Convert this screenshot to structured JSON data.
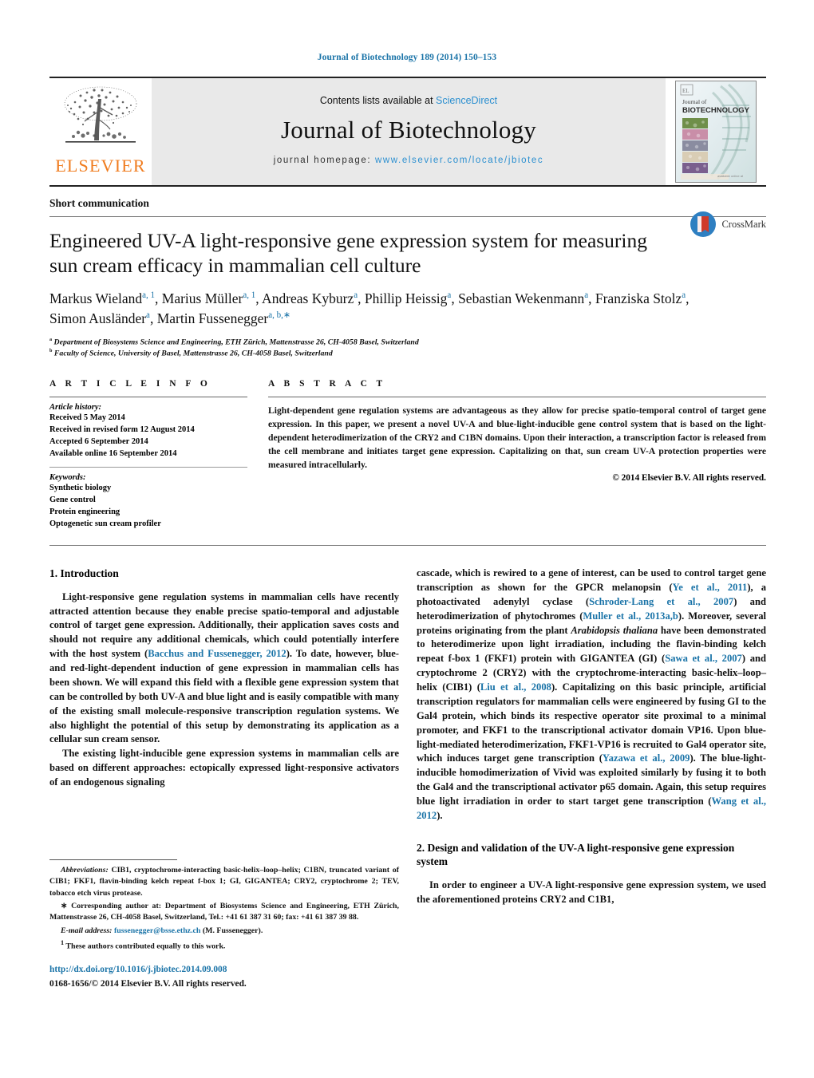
{
  "running_head": "Journal of Biotechnology 189 (2014) 150–153",
  "masthead": {
    "publisher_name": "ELSEVIER",
    "contents_prefix": "Contents lists available at ",
    "sciencedirect": "ScienceDirect",
    "journal_title": "Journal of Biotechnology",
    "homepage_label": "journal homepage:",
    "homepage_url": "www.elsevier.com/locate/jbiotec",
    "cover": {
      "line1": "Journal of",
      "line2": "BIOTECHNOLOGY"
    }
  },
  "article": {
    "section_type": "Short communication",
    "title": "Engineered UV-A light-responsive gene expression system for measuring sun cream efficacy in mammalian cell culture",
    "authors_html": "Markus Wieland<sup>a, 1</sup>, Marius Müller<sup>a, 1</sup>, Andreas Kyburz<sup>a</sup>, Phillip Heissig<sup>a</sup>, Sebastian Wekenmann<sup>a</sup>, Franziska Stolz<sup>a</sup>, Simon Ausländer<sup>a</sup>, Martin Fussenegger<sup>a, b,</sup><sup>∗</sup>",
    "affiliation_a": "Department of Biosystems Science and Engineering, ETH Zürich, Mattenstrasse 26, CH-4058 Basel, Switzerland",
    "affiliation_b": "Faculty of Science, University of Basel, Mattenstrasse 26, CH-4058 Basel, Switzerland",
    "crossmark_label": "CrossMark"
  },
  "article_info": {
    "heading": "A R T I C L E    I N F O",
    "history_label": "Article history:",
    "history": [
      "Received 5 May 2014",
      "Received in revised form 12 August 2014",
      "Accepted 6 September 2014",
      "Available online 16 September 2014"
    ],
    "keywords_label": "Keywords:",
    "keywords": [
      "Synthetic biology",
      "Gene control",
      "Protein engineering",
      "Optogenetic sun cream profiler"
    ]
  },
  "abstract": {
    "heading": "A B S T R A C T",
    "text": "Light-dependent gene regulation systems are advantageous as they allow for precise spatio-temporal control of target gene expression. In this paper, we present a novel UV-A and blue-light-inducible gene control system that is based on the light-dependent heterodimerization of the CRY2 and C1BN domains. Upon their interaction, a transcription factor is released from the cell membrane and initiates target gene expression. Capitalizing on that, sun cream UV-A protection properties were measured intracellularly.",
    "copyright": "© 2014 Elsevier B.V. All rights reserved."
  },
  "body": {
    "intro_heading": "1.  Introduction",
    "left_p1_html": "Light-responsive gene regulation systems in mammalian cells have recently attracted attention because they enable precise spatio-temporal and adjustable control of target gene expression. Additionally, their application saves costs and should not require any additional chemicals, which could potentially interfere with the host system (<span class=\"cite\">Bacchus and Fussenegger, 2012</span>). To date, however, blue- and red-light-dependent induction of gene expression in mammalian cells has been shown. We will expand this field with a flexible gene expression system that can be controlled by both UV-A and blue light and is easily compatible with many of the existing small molecule-responsive transcription regulation systems. We also highlight the potential of this setup by demonstrating its application as a cellular sun cream sensor.",
    "left_p2_html": "The existing light-inducible gene expression systems in mammalian cells are based on different approaches: ectopically expressed light-responsive activators of an endogenous signaling",
    "right_p1_html": "cascade, which is rewired to a gene of interest, can be used to control target gene transcription as shown for the GPCR melanopsin (<span class=\"cite\">Ye et al., 2011</span>), a photoactivated adenylyl cyclase (<span class=\"cite\">Schroder-Lang et al., 2007</span>) and heterodimerization of phytochromes (<span class=\"cite\">Muller et al., 2013a,b</span>). Moreover, several proteins originating from the plant <span class=\"ital\">Arabidopsis thaliana</span> have been demonstrated to heterodimerize upon light irradiation, including the flavin-binding kelch repeat f-box 1 (FKF1) protein with GIGANTEA (GI) (<span class=\"cite\">Sawa et al., 2007</span>) and cryptochrome 2 (CRY2) with the cryptochrome-interacting basic-helix–loop–helix (CIB1) (<span class=\"cite\">Liu et al., 2008</span>). Capitalizing on this basic principle, artificial transcription regulators for mammalian cells were engineered by fusing GI to the Gal4 protein, which binds its respective operator site proximal to a minimal promoter, and FKF1 to the transcriptional activator domain VP16. Upon blue-light-mediated heterodimerization, FKF1-VP16 is recruited to Gal4 operator site, which induces target gene transcription (<span class=\"cite\">Yazawa et al., 2009</span>). The blue-light-inducible homodimerization of Vivid was exploited similarly by fusing it to both the Gal4 and the transcriptional activator p65 domain. Again, this setup requires blue light irradiation in order to start target gene transcription (<span class=\"cite\">Wang et al., 2012</span>).",
    "design_heading": "2.  Design and validation of the UV-A light-responsive gene expression system",
    "right_p2_html": "In order to engineer a UV-A light-responsive gene expression system, we used the aforementioned proteins CRY2 and C1B1,"
  },
  "footnotes": {
    "abbreviations_html": "<span class=\"lbl\">Abbreviations:</span>  CIB1, cryptochrome-interacting basic-helix–loop–helix; C1BN, truncated variant of CIB1; FKF1, flavin-binding kelch repeat f-box 1; GI, GIGANTEA; CRY2, cryptochrome 2; TEV, tobacco etch virus protease.",
    "corresponding_html": "∗ Corresponding author at: Department of Biosystems Science and Engineering, ETH Zürich, Mattenstrasse 26, CH-4058 Basel, Switzerland, Tel.: +41 61 387 31 60; fax: +41 61 387 39 88.",
    "email_label": "E-mail address:",
    "email": "fussenegger@bsse.ethz.ch",
    "email_suffix": " (M. Fussenegger).",
    "equal_contrib_html": "<sup>1</sup> These authors contributed equally to this work."
  },
  "footer": {
    "doi": "http://dx.doi.org/10.1016/j.jbiotec.2014.09.008",
    "issn": "0168-1656/© 2014 Elsevier B.V. All rights reserved."
  },
  "colors": {
    "link_blue": "#1b74a8",
    "sd_blue": "#2b8fd0",
    "elsevier_orange": "#f07c1f",
    "band_gray": "#e9e9e9"
  }
}
